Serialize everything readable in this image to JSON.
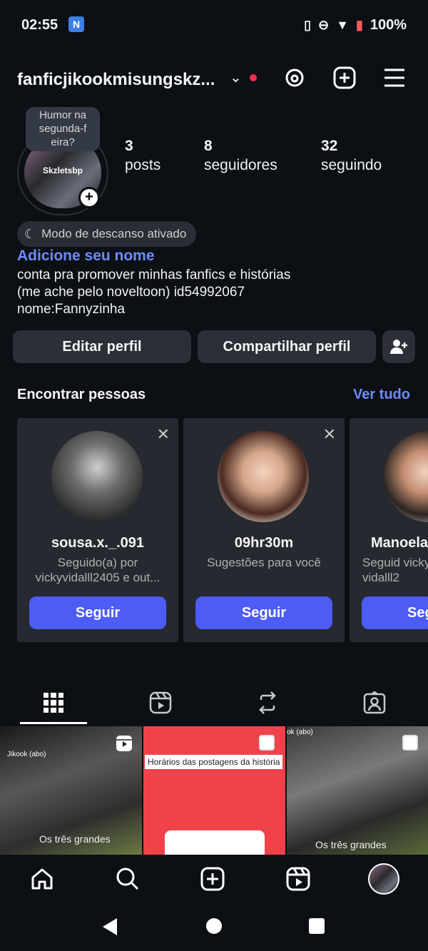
{
  "status_bar": {
    "time": "02:55",
    "battery": "100%"
  },
  "header": {
    "username": "fanficjikookmisungskz..."
  },
  "profile": {
    "note_bubble": "Humor na segunda-f eira?",
    "avatar_caption": "Skzletsbp",
    "stats": [
      {
        "value": "3",
        "label": "posts"
      },
      {
        "value": "8",
        "label": "seguidores"
      },
      {
        "value": "32",
        "label": "seguindo"
      }
    ],
    "rest_mode": "Modo de descanso ativado",
    "add_name": "Adicione seu nome",
    "bio_lines": [
      "conta pra promover minhas fanfics e histórias",
      "(me ache pelo noveltoon) id54992067",
      "nome:Fannyzinha"
    ]
  },
  "actions": {
    "edit": "Editar perfil",
    "share": "Compartilhar perfil"
  },
  "suggestions": {
    "title": "Encontrar pessoas",
    "see_all": "Ver tudo",
    "cards": [
      {
        "username": "sousa.x._.091",
        "subtitle": "Seguido(a) por vickyvidalll2405 e out...",
        "button": "Seguir"
      },
      {
        "username": "09hr30m",
        "subtitle": "Sugestões para você",
        "button": "Seguir"
      },
      {
        "username": "Manoela",
        "subtitle": "Seguid vickyvidalll2",
        "button": "Seg"
      }
    ]
  },
  "grid": {
    "items": [
      {
        "caption_top": "Jikook (abo)",
        "caption_bottom": "Os três grandes"
      },
      {
        "caption_top": "Horários das postagens da história",
        "caption_bottom": ""
      },
      {
        "caption_top": "ok (abo)",
        "caption_bottom": "Os três grandes"
      }
    ]
  }
}
